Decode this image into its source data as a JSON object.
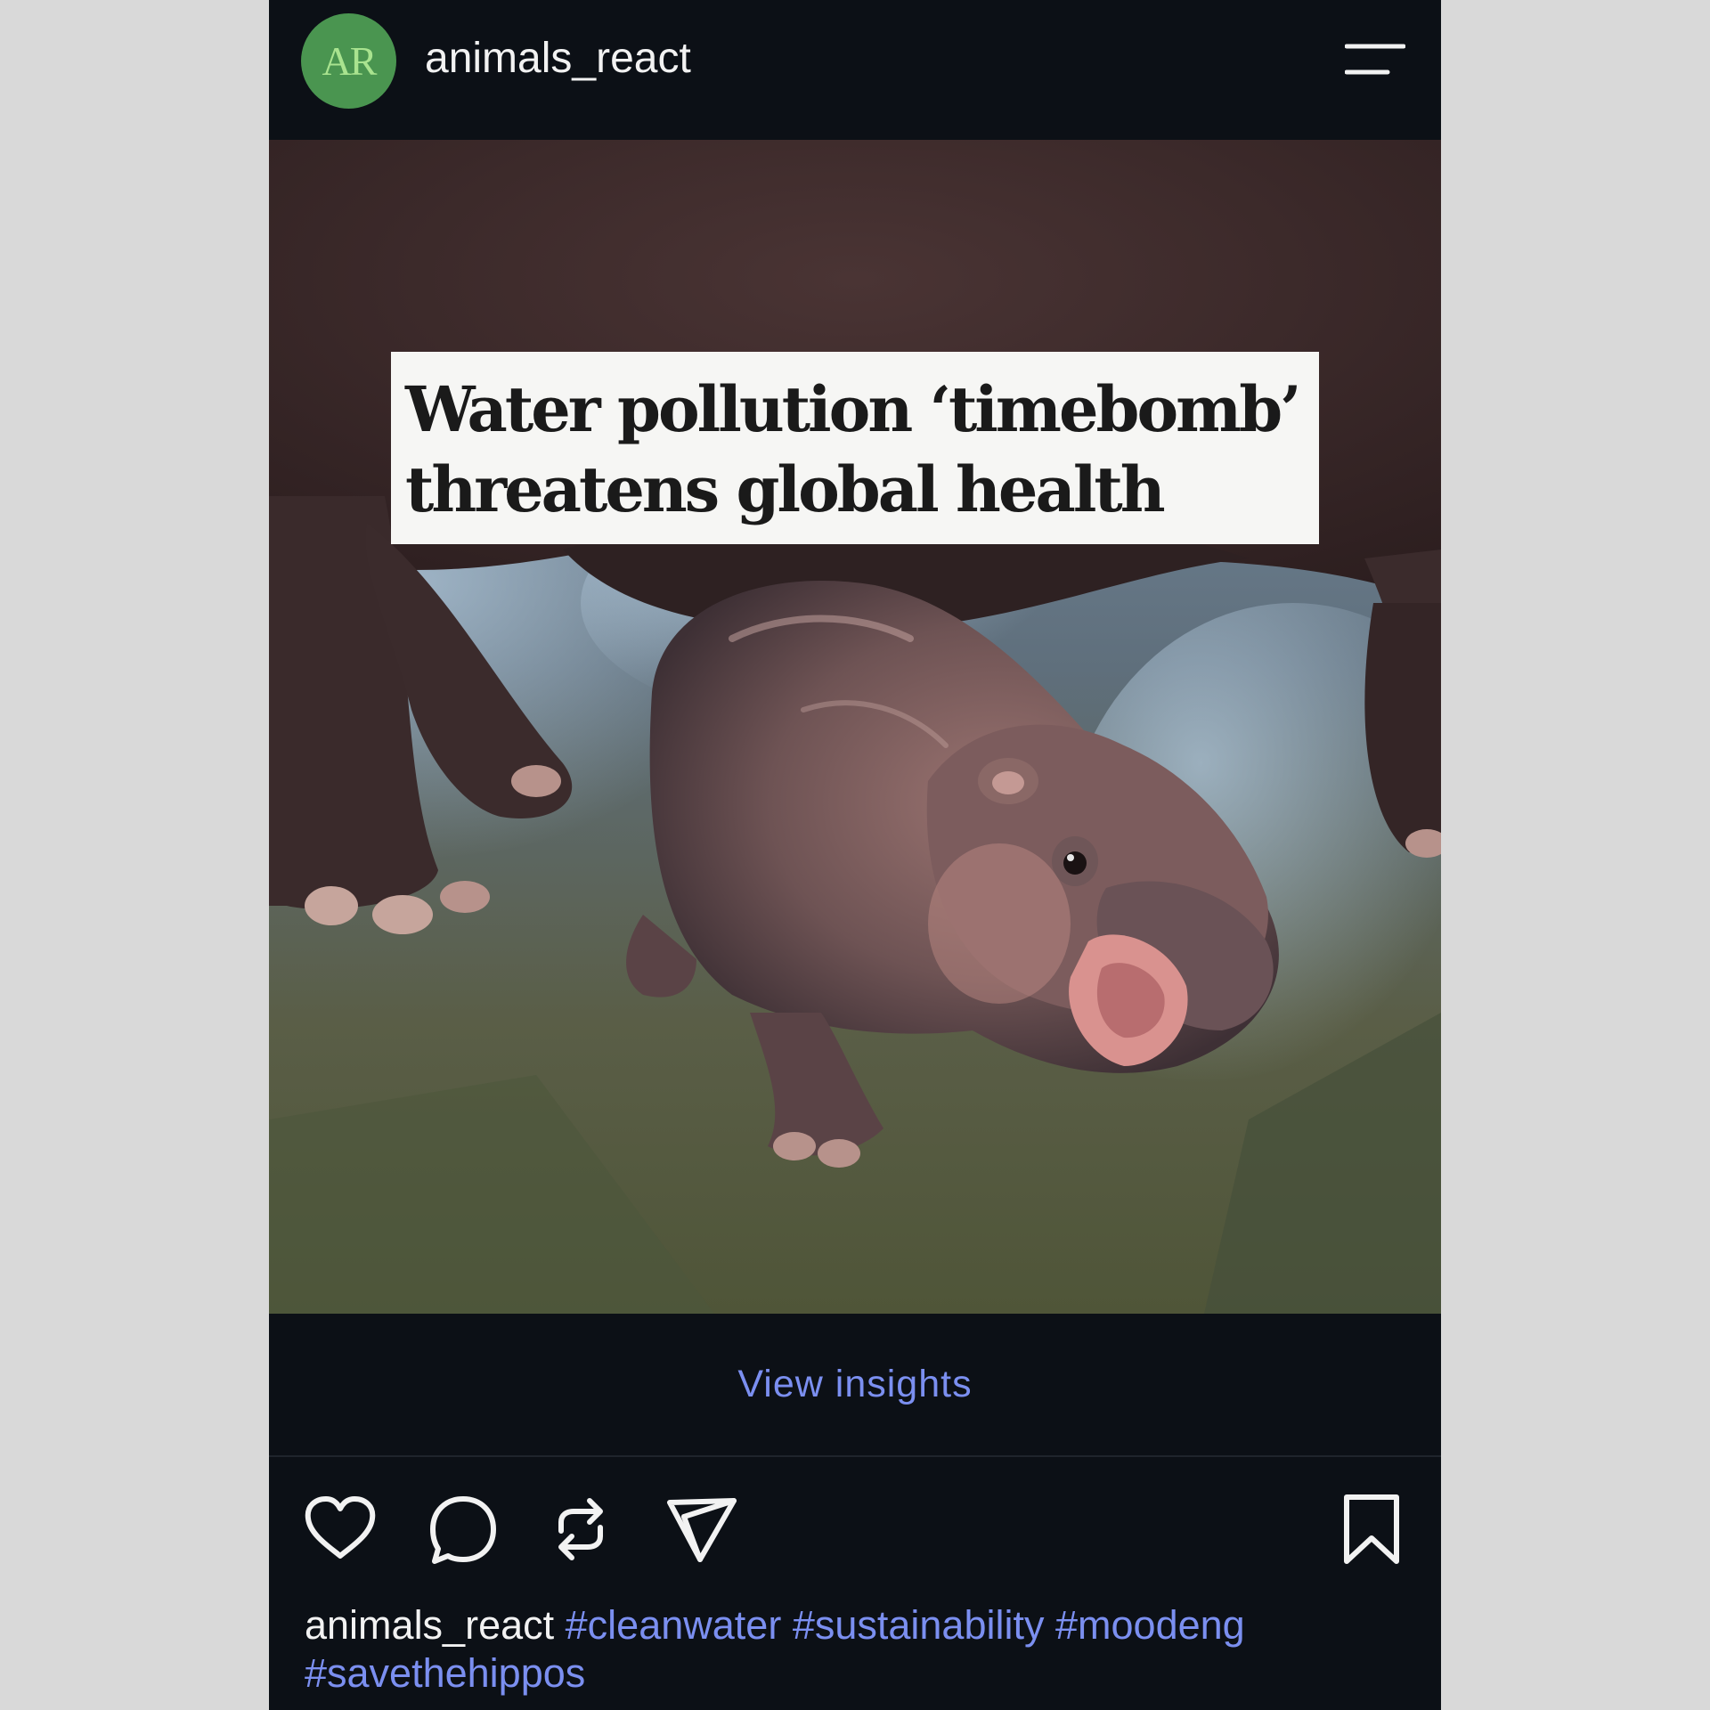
{
  "post": {
    "avatar_initials": "AR",
    "username": "animals_react",
    "menu_icon": "menu-icon"
  },
  "photo": {
    "headline_line1": "Water pollution ‘timebomb’",
    "headline_line2": "threatens global health"
  },
  "insights": {
    "label": "View insights"
  },
  "actions": {
    "icons": [
      "heart-icon",
      "comment-icon",
      "repost-icon",
      "send-icon",
      "bookmark-icon"
    ]
  },
  "caption": {
    "username": "animals_react",
    "hashtags": [
      "#cleanwater",
      "#sustainability",
      "#moodeng",
      "#savethehippos"
    ]
  },
  "colors": {
    "background": "#0c1016",
    "link": "#7b8ff0",
    "avatar": "#4a9550",
    "page": "#d9d9d9"
  }
}
